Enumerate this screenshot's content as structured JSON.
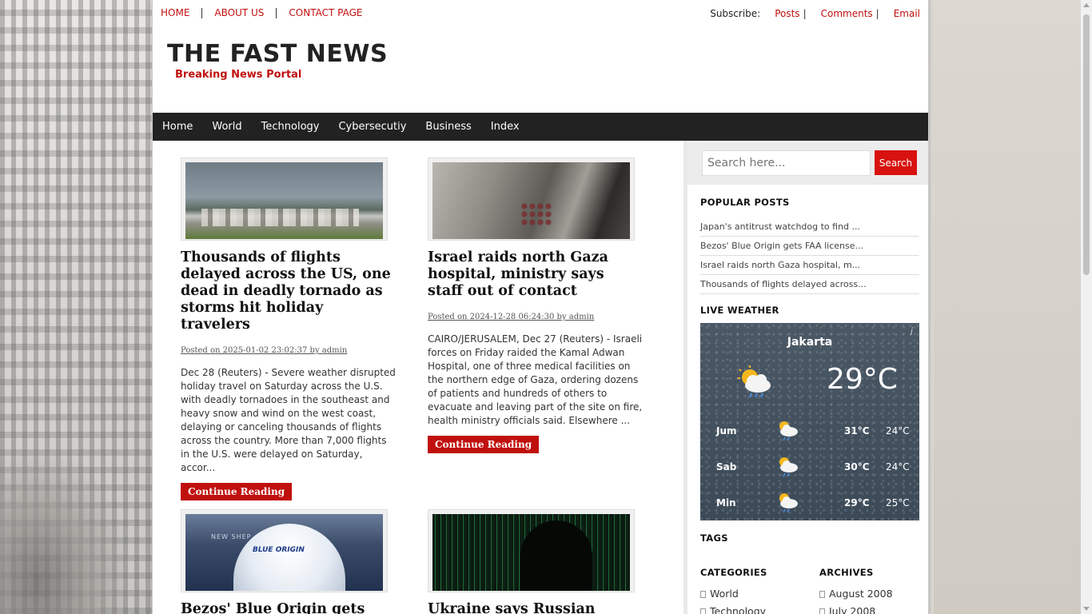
{
  "top_links": [
    "HOME",
    "ABOUT US",
    "CONTACT PAGE"
  ],
  "subscribe": {
    "label": "Subscribe:",
    "posts": "Posts",
    "comments": "Comments",
    "email": "Email",
    "sep": "|"
  },
  "site": {
    "title": "THE FAST NEWS",
    "tagline": "Breaking News Portal"
  },
  "nav": [
    "Home",
    "World",
    "Technology",
    "Cybersecutiy",
    "Business",
    "Index"
  ],
  "posts": [
    {
      "title": "Thousands of flights delayed across the US, one dead in deadly tornado as storms hit holiday travelers",
      "meta": "Posted on 2025-01-02 23:02:37 by admin",
      "excerpt": "Dec 28 (Reuters) - Severe weather disrupted holiday travel on Saturday across the U.S. with deadly tornadoes in the southeast and heavy snow and wind on the west coast, delaying or canceling thousands of flights across the country. More than 7,000 flights in the U.S. were delayed on Saturday, accor...",
      "button": "Continue Reading"
    },
    {
      "title": "Israel raids north Gaza hospital, ministry says staff out of contact",
      "meta": "Posted on 2024-12-28 06:24:30 by admin",
      "excerpt": "CAIRO/JERUSALEM, Dec 27 (Reuters) - Israeli forces on Friday raided the Kamal Adwan Hospital, one of three medical facilities on the northern edge of Gaza, ordering dozens of patients and hundreds of others to evacuate and leaving part of the site on fire, health ministry officials said. Elsewhere ...",
      "button": "Continue Reading"
    },
    {
      "title": "Bezos' Blue Origin gets FAA",
      "image_text_1": "NEW SHEP",
      "image_text_2": "BLUE ORIGIN"
    },
    {
      "title": "Ukraine says Russian"
    }
  ],
  "sidebar": {
    "search_placeholder": "Search here...",
    "search_button": "Search",
    "popular_title": "POPULAR POSTS",
    "popular": [
      "Japan's antitrust watchdog to find ...",
      "Bezos' Blue Origin gets FAA license...",
      "Israel raids north Gaza hospital, m...",
      "Thousands of flights delayed across..."
    ],
    "weather_title": "LIVE WEATHER",
    "weather": {
      "city": "Jakarta",
      "info": "i",
      "temp": "29°C",
      "forecast": [
        {
          "day": "Jum",
          "hi": "31°C",
          "lo": "24°C"
        },
        {
          "day": "Sab",
          "hi": "30°C",
          "lo": "24°C"
        },
        {
          "day": "Min",
          "hi": "29°C",
          "lo": "25°C"
        }
      ]
    },
    "tags_title": "TAGS",
    "categories_title": "CATEGORIES",
    "archives_title": "ARCHIVES",
    "categories": [
      "World",
      "Technology"
    ],
    "archives": [
      "August 2008",
      "July 2008"
    ]
  },
  "colors": {
    "accent": "#c0100e",
    "nav_bg": "#222222"
  }
}
